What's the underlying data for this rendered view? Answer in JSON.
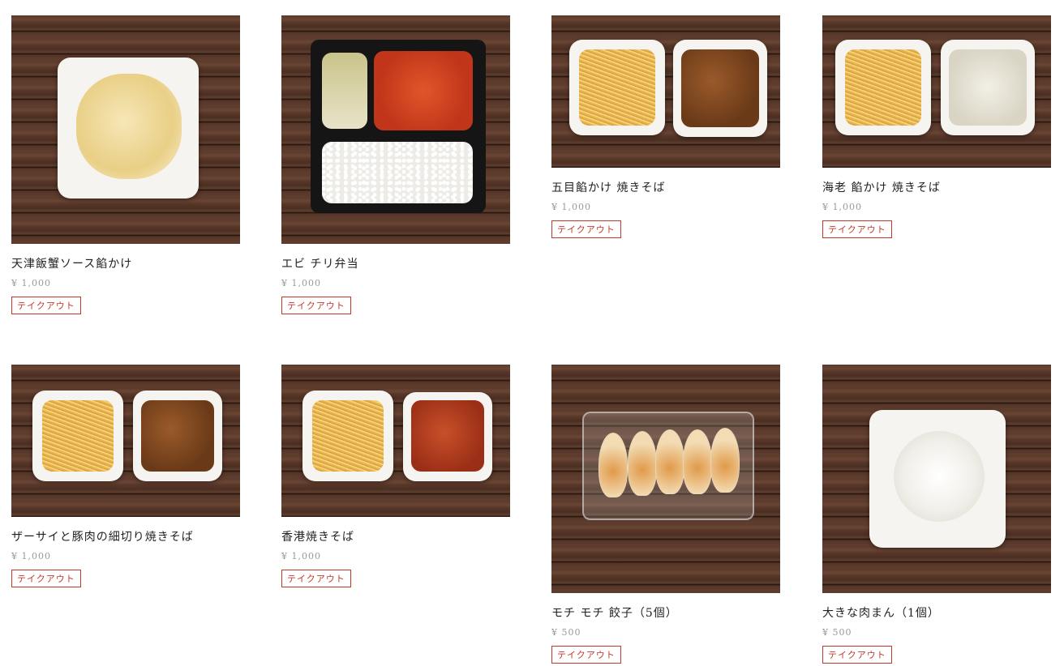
{
  "products": [
    {
      "name": "天津飯蟹ソース餡かけ",
      "price": "¥ 1,000",
      "tag": "テイクアウト",
      "image": "tenshinhan"
    },
    {
      "name": "エビ チリ弁当",
      "price": "¥ 1,000",
      "tag": "テイクアウト",
      "image": "ebichili-bento"
    },
    {
      "name": "五目餡かけ 焼きそば",
      "price": "¥ 1,000",
      "tag": "テイクアウト",
      "image": "gomoku-yakisoba"
    },
    {
      "name": "海老 餡かけ 焼きそば",
      "price": "¥ 1,000",
      "tag": "テイクアウト",
      "image": "ebi-yakisoba"
    },
    {
      "name": "ザーサイと豚肉の細切り焼きそば",
      "price": "¥ 1,000",
      "tag": "テイクアウト",
      "image": "zasai-yakisoba"
    },
    {
      "name": "香港焼きそば",
      "price": "¥ 1,000",
      "tag": "テイクアウト",
      "image": "hongkong-yakisoba"
    },
    {
      "name": "モチ モチ 餃子（5個）",
      "price": "¥ 500",
      "tag": "テイクアウト",
      "image": "gyoza"
    },
    {
      "name": "大きな肉まん（1個）",
      "price": "¥ 500",
      "tag": "テイクアウト",
      "image": "nikuman"
    }
  ],
  "colors": {
    "tag_accent": "#c0392b",
    "price_text": "#999999",
    "wood": "#5b3a2b"
  }
}
